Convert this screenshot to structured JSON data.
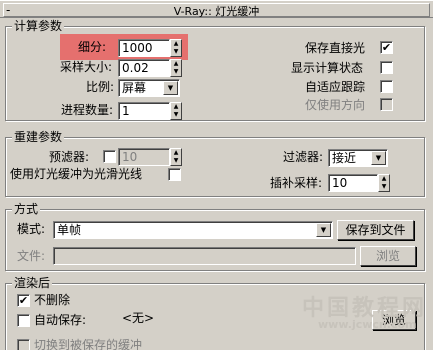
{
  "rollout": {
    "title": "V-Ray:: 灯光缓冲",
    "collapse": "-"
  },
  "calc": {
    "title": "计算参数",
    "subdivs_label": "细分:",
    "subdivs_value": "1000",
    "sample_size_label": "采样大小:",
    "sample_size_value": "0.02",
    "scale_label": "比例:",
    "scale_value": "屏幕",
    "passes_label": "进程数量:",
    "passes_value": "1",
    "store_direct_label": "保存直接光",
    "store_direct_checked": "✔",
    "show_calc_label": "显示计算状态",
    "adaptive_label": "自适应跟踪",
    "dirs_only_label": "仅使用方向"
  },
  "recon": {
    "title": "重建参数",
    "prefilter_label": "预滤器:",
    "prefilter_value": "10",
    "glossy_label": "使用灯光缓冲为光滑光线",
    "filter_label": "过滤器:",
    "filter_value": "接近",
    "interp_label": "插补采样:",
    "interp_value": "10"
  },
  "mode": {
    "title": "方式",
    "mode_label": "模式:",
    "mode_value": "单帧",
    "save_button": "保存到文件",
    "file_label": "文件:",
    "browse_button": "浏览"
  },
  "after": {
    "title": "渲染后",
    "dont_delete_label": "不删除",
    "dont_delete_checked": "✔",
    "autosave_label": "自动保存:",
    "autosave_value": "<无>",
    "browse_button": "浏览",
    "switch_label": "切换到被保存的缓冲"
  },
  "watermark": {
    "title": "中国教程网",
    "url": "www.jcwcn.com"
  },
  "colors": {
    "highlight": "#eb5050",
    "panel": "#d4d0c8"
  }
}
